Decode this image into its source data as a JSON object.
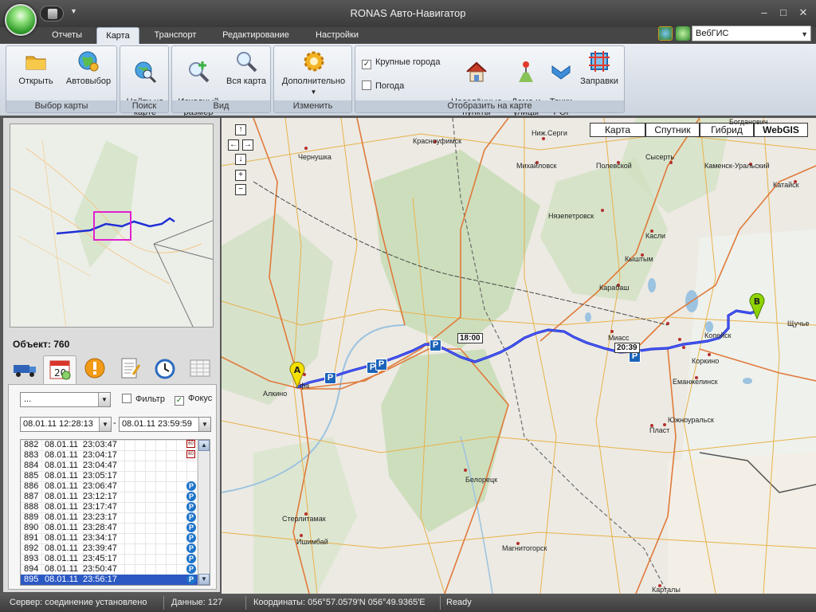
{
  "window": {
    "title": "RONAS Авто-Навигатор",
    "minimize": "–",
    "maximize": "□",
    "close": "✕",
    "qat_arrow": "▼"
  },
  "tabs": [
    "Отчеты",
    "Карта",
    "Транспорт",
    "Редактирование",
    "Настройки"
  ],
  "active_tab": "Карта",
  "map_source": {
    "value": "ВебГИС",
    "arrow": "▼"
  },
  "ribbon": {
    "groups": [
      {
        "title": "Выбор карты",
        "buttons": [
          {
            "label": "Открыть",
            "icon": "folder-icon"
          },
          {
            "label": "Автовыбор",
            "icon": "globe-gear-icon"
          }
        ]
      },
      {
        "title": "Поиск",
        "buttons": [
          {
            "label": "Найти на\nкарте",
            "icon": "globe-search-icon"
          }
        ]
      },
      {
        "title": "Вид",
        "buttons": [
          {
            "label": "Исходный\nразмер",
            "icon": "zoom-in-icon"
          },
          {
            "label": "Вся карта",
            "icon": "zoom-fit-icon"
          }
        ]
      },
      {
        "title": "Изменить",
        "buttons": [
          {
            "label": "Дополнительно",
            "icon": "gear-icon",
            "arrow": "▼"
          }
        ]
      },
      {
        "title": "Отобразить на карте",
        "checks": [
          {
            "label": "Крупные города",
            "checked": true
          },
          {
            "label": "Погода",
            "checked": false
          }
        ],
        "buttons": [
          {
            "label": "Населённые\nпункты",
            "icon": "house-icon"
          },
          {
            "label": "Дома и\nулицы",
            "icon": "street-icon"
          },
          {
            "label": "Точки\nPOI",
            "icon": "poi-icon"
          },
          {
            "label": "Заправки",
            "icon": "fuel-icon"
          }
        ]
      }
    ]
  },
  "left": {
    "object_label": "Объект:",
    "object_value": "760",
    "filter_value": "...",
    "filter_arrow": "▼",
    "filter_label": "Фильтр",
    "filter_checked": false,
    "focus_label": "Фокус",
    "focus_checked": true,
    "date_from": "08.01.11  12:28:13",
    "date_to": "08.01.11  23:59:59",
    "date_dash": "-",
    "tab_icons": [
      "truck-icon",
      "calendar-icon",
      "alert-icon",
      "report-icon",
      "clock-icon",
      "table-icon"
    ],
    "scroll_up": "▲",
    "scroll_down": "▼",
    "log": [
      {
        "n": "882",
        "d": "08.01.11",
        "t": "23:03:47",
        "badge": "60"
      },
      {
        "n": "883",
        "d": "08.01.11",
        "t": "23:04:17",
        "badge": "60"
      },
      {
        "n": "884",
        "d": "08.01.11",
        "t": "23:04:47",
        "badge": ""
      },
      {
        "n": "885",
        "d": "08.01.11",
        "t": "23:05:17",
        "badge": ""
      },
      {
        "n": "886",
        "d": "08.01.11",
        "t": "23:06:47",
        "badge": "P"
      },
      {
        "n": "887",
        "d": "08.01.11",
        "t": "23:12:17",
        "badge": "P"
      },
      {
        "n": "888",
        "d": "08.01.11",
        "t": "23:17:47",
        "badge": "P"
      },
      {
        "n": "889",
        "d": "08.01.11",
        "t": "23:23:17",
        "badge": "P"
      },
      {
        "n": "890",
        "d": "08.01.11",
        "t": "23:28:47",
        "badge": "P"
      },
      {
        "n": "891",
        "d": "08.01.11",
        "t": "23:34:17",
        "badge": "P"
      },
      {
        "n": "892",
        "d": "08.01.11",
        "t": "23:39:47",
        "badge": "P"
      },
      {
        "n": "893",
        "d": "08.01.11",
        "t": "23:45:17",
        "badge": "P"
      },
      {
        "n": "894",
        "d": "08.01.11",
        "t": "23:50:47",
        "badge": "P"
      },
      {
        "n": "895",
        "d": "08.01.11",
        "t": "23:56:17",
        "badge": "P",
        "selected": true
      }
    ]
  },
  "map": {
    "types": [
      "Карта",
      "Спутник",
      "Гибрид",
      "WebGIS"
    ],
    "active_type": "WebGIS",
    "nav": {
      "up": "↑",
      "left": "←",
      "right": "→",
      "down": "↓",
      "zoom_in": "+",
      "zoom_out": "−"
    },
    "start_marker": "A",
    "end_marker": "B",
    "parking_label": "P",
    "time_labels": [
      "18:00",
      "20:39"
    ],
    "cities": [
      "Ниж.Серги",
      "Красноуфимск",
      "Чернушка",
      "Михайловск",
      "Полевской",
      "Сысерть",
      "Каменск-Уральский",
      "Богданович",
      "Катайск",
      "Нязепетровск",
      "Касли",
      "Кыштым",
      "Карабаш",
      "Щучье",
      "Миасс",
      "Копейск",
      "Коркино",
      "Еманжелинск",
      "Южноуральск",
      "Пласт",
      "Уфа",
      "Алкино",
      "Белорецк",
      "Стерлитамак",
      "Ишимбай",
      "Магнитогорск",
      "Карталы"
    ],
    "colors": {
      "route": "#1f2fd6",
      "road_major": "#e07a3a",
      "road_minor": "#e8b24a",
      "forest": "#c6dcb4",
      "water": "#9cc3e0"
    }
  },
  "status": {
    "server": "Сервер: соединение установлено",
    "data": "Данные: 127",
    "coords": "Координаты: 056°57.0579'N  056°49.9365'E",
    "ready": "Ready"
  }
}
